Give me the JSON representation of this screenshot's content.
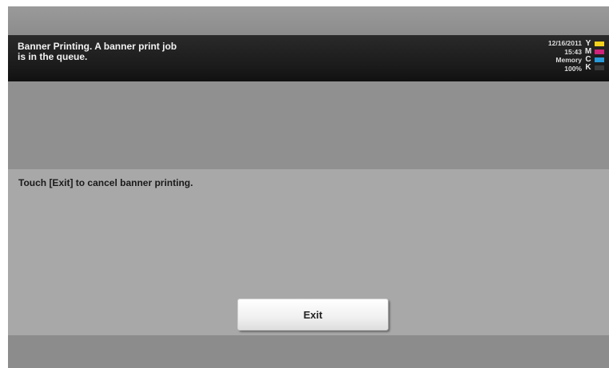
{
  "header": {
    "message": "Banner Printing. A banner print job\nis in the queue.",
    "date": "12/16/2011",
    "time": "15:43",
    "memory_label": "Memory",
    "memory_value": "100%"
  },
  "toner": [
    {
      "letter": "Y",
      "color": "#f2d21b"
    },
    {
      "letter": "M",
      "color": "#d0247a"
    },
    {
      "letter": "C",
      "color": "#2a9ad8"
    },
    {
      "letter": "K",
      "color": "#3a3a3a"
    }
  ],
  "panel": {
    "message": "Touch [Exit] to cancel banner printing.",
    "exit_label": "Exit"
  }
}
